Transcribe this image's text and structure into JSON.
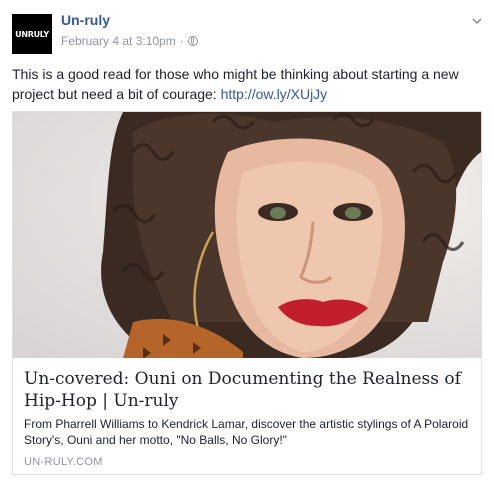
{
  "post": {
    "avatar_text": "UNRULY",
    "page_name": "Un-ruly",
    "timestamp": "February 4 at 3:10pm",
    "separator": "·",
    "privacy_icon": "globe-icon",
    "text": "This is a good read for those who might be thinking about starting a new project but need a bit of courage: ",
    "link": "http://ow.ly/XUjJy"
  },
  "card": {
    "image_subject": "portrait-photo",
    "title": "Un-covered: Ouni on Documenting the Realness of Hip-Hop | Un-ruly",
    "description": "From Pharrell Williams to Kendrick Lamar, discover the artistic stylings of A Polaroid Story's, Ouni and her motto, \"No Balls, No Glory!\"",
    "domain": "UN-RULY.COM"
  },
  "colors": {
    "link": "#365899",
    "meta": "#90949c",
    "text": "#1d2129",
    "border": "#dddfe2"
  }
}
